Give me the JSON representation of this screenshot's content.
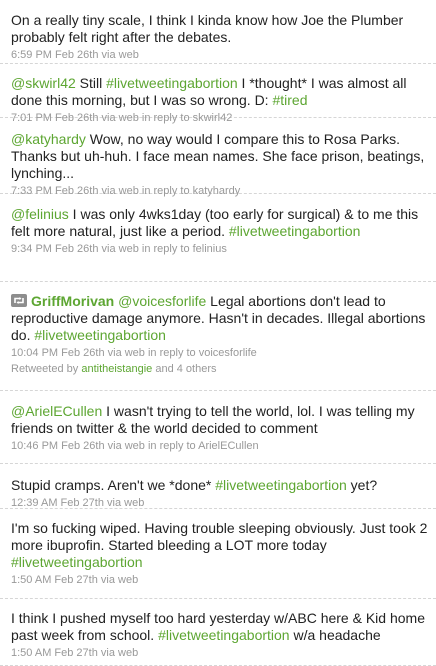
{
  "tweets": [
    {
      "parts": [
        {
          "t": "On a really tiny scale, I think I kinda know how Joe the Plumber probably felt right after the debates.",
          "link": false
        }
      ],
      "time": "6:59 PM Feb 26th",
      "via": " via web"
    },
    {
      "parts": [
        {
          "t": "@skwirl42",
          "link": true
        },
        {
          "t": " Still ",
          "link": false
        },
        {
          "t": "#livetweetingabortion",
          "link": true
        },
        {
          "t": " I *thought* I was almost all done this morning, but I was so wrong. D: ",
          "link": false
        },
        {
          "t": "#tired",
          "link": true
        }
      ],
      "time": "7:01 PM Feb 26th",
      "via": " via web",
      "reply": " in reply to skwirl42"
    },
    {
      "parts": [
        {
          "t": "@katyhardy",
          "link": true
        },
        {
          "t": " Wow, no way would I compare this to Rosa Parks. Thanks but uh-huh. I face mean names. She face prison, beatings, lynching...",
          "link": false
        }
      ],
      "time": "7:33 PM Feb 26th",
      "via": " via web",
      "reply": " in reply to katyhardy"
    },
    {
      "parts": [
        {
          "t": "@felinius",
          "link": true
        },
        {
          "t": " I was only 4wks1day (too early for surgical) & to me this felt more natural, just like a period. ",
          "link": false
        },
        {
          "t": "#livetweetingabortion",
          "link": true
        }
      ],
      "time": "9:34 PM Feb 26th",
      "via": " via web",
      "reply": " in reply to felinius"
    },
    {
      "retweet_user": "GriffMorivan",
      "parts": [
        {
          "t": " ",
          "link": false
        },
        {
          "t": "@voicesforlife",
          "link": true
        },
        {
          "t": " Legal abortions don't lead to reproductive damage anymore. Hasn't in decades. Illegal abortions do. ",
          "link": false
        },
        {
          "t": "#livetweetingabortion",
          "link": true
        }
      ],
      "time": "10:04 PM Feb 26th",
      "via": " via web",
      "reply": " in reply to voicesforlife",
      "rt_prefix": "Retweeted by ",
      "rt_user": "antitheistangie",
      "rt_suffix": " and 4 others"
    },
    {
      "parts": [
        {
          "t": "@ArielECullen",
          "link": true
        },
        {
          "t": " I wasn't trying to tell the world, lol. I was telling my friends on twitter & the world decided to comment",
          "link": false
        }
      ],
      "time": "10:46 PM Feb 26th",
      "via": " via web",
      "reply": " in reply to ArielECullen"
    },
    {
      "parts": [
        {
          "t": "Stupid cramps. Aren't we *done* ",
          "link": false
        },
        {
          "t": "#livetweetingabortion",
          "link": true
        },
        {
          "t": " yet?",
          "link": false
        }
      ],
      "time": "12:39 AM Feb 27th",
      "via": " via web"
    },
    {
      "parts": [
        {
          "t": "I'm so fucking wiped. Having trouble sleeping obviously. Just took 2 more ibuprofin. Started bleeding a LOT more today ",
          "link": false
        },
        {
          "t": "#livetweetingabortion",
          "link": true
        }
      ],
      "time": "1:50 AM Feb 27th",
      "via": " via web"
    },
    {
      "parts": [
        {
          "t": "I think I pushed myself too hard yesterday w/ABC here & Kid home past week from school. ",
          "link": false
        },
        {
          "t": "#livetweetingabortion",
          "link": true
        },
        {
          "t": " w/a headache",
          "link": false
        }
      ],
      "time": "1:50 AM Feb 27th",
      "via": " via web"
    }
  ],
  "colors": {
    "link": "#5da632",
    "meta": "#999999",
    "text": "#222222"
  }
}
